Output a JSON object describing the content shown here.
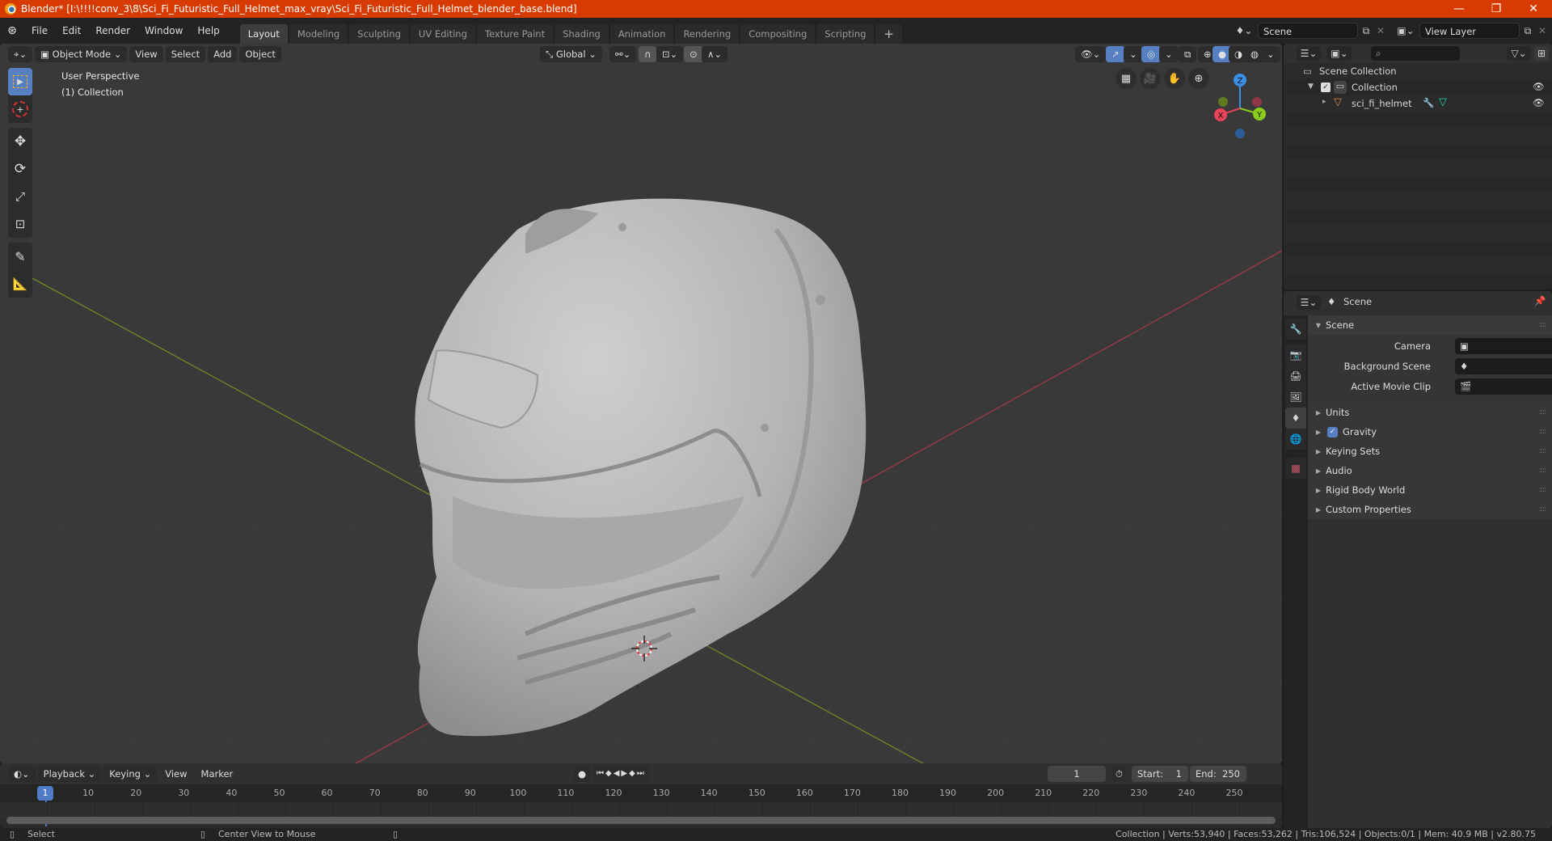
{
  "window": {
    "title": "Blender* [I:\\!!!!conv_3\\8\\Sci_Fi_Futuristic_Full_Helmet_max_vray\\Sci_Fi_Futuristic_Full_Helmet_blender_base.blend]",
    "controls": {
      "minimize": "—",
      "maximize": "❐",
      "close": "✕"
    }
  },
  "menu": {
    "items": [
      "File",
      "Edit",
      "Render",
      "Window",
      "Help"
    ],
    "workspaces": [
      "Layout",
      "Modeling",
      "Sculpting",
      "UV Editing",
      "Texture Paint",
      "Shading",
      "Animation",
      "Rendering",
      "Compositing",
      "Scripting"
    ],
    "active_workspace": "Layout",
    "add_workspace": "+",
    "scene": "Scene",
    "view_layer": "View Layer"
  },
  "viewport": {
    "mode": "Object Mode",
    "menus": [
      "View",
      "Select",
      "Add",
      "Object"
    ],
    "orientation": "Global",
    "overlay_text": {
      "line1": "User Perspective",
      "line2": "(1) Collection"
    },
    "tools": [
      "select-box",
      "cursor",
      "move",
      "rotate",
      "scale",
      "transform",
      "annotate",
      "measure"
    ],
    "gizmo_axes": {
      "x": "X",
      "y": "Y",
      "z": "Z"
    },
    "colors": {
      "x_axis": "#e8435a",
      "y_axis": "#8ccc1a",
      "z_axis": "#3a8ee6",
      "grid_x": "#9c3a46",
      "grid_y": "#6c8a24",
      "background": "#393939",
      "accent": "#5680c2"
    }
  },
  "outliner": {
    "search_placeholder": "",
    "rows": [
      {
        "label": "Scene Collection",
        "type": "scene-collection"
      },
      {
        "label": "Collection",
        "type": "collection",
        "checked": true
      },
      {
        "label": "sci_fi_helmet",
        "type": "mesh-object"
      }
    ]
  },
  "properties": {
    "header_title": "Scene",
    "section": "Scene",
    "fields": [
      {
        "label": "Camera",
        "value": ""
      },
      {
        "label": "Background Scene",
        "value": ""
      },
      {
        "label": "Active Movie Clip",
        "value": ""
      }
    ],
    "panels": [
      {
        "label": "Units",
        "checkbox": false
      },
      {
        "label": "Gravity",
        "checkbox": true
      },
      {
        "label": "Keying Sets",
        "checkbox": false
      },
      {
        "label": "Audio",
        "checkbox": false
      },
      {
        "label": "Rigid Body World",
        "checkbox": false
      },
      {
        "label": "Custom Properties",
        "checkbox": false
      }
    ]
  },
  "timeline": {
    "menus": [
      "Playback",
      "Keying",
      "View",
      "Marker"
    ],
    "current_frame": "1",
    "start_label": "Start:",
    "start": "1",
    "end_label": "End:",
    "end": "250",
    "ticks": [
      "10",
      "20",
      "30",
      "40",
      "50",
      "60",
      "70",
      "80",
      "90",
      "100",
      "110",
      "120",
      "130",
      "140",
      "150",
      "160",
      "170",
      "180",
      "190",
      "200",
      "210",
      "220",
      "230",
      "240",
      "250"
    ]
  },
  "statusbar": {
    "left_hint": "Select",
    "middle_hint": "Center View to Mouse",
    "stats": "Collection | Verts:53,940 | Faces:53,262 | Tris:106,524 | Objects:0/1 | Mem: 40.9 MB | v2.80.75"
  }
}
